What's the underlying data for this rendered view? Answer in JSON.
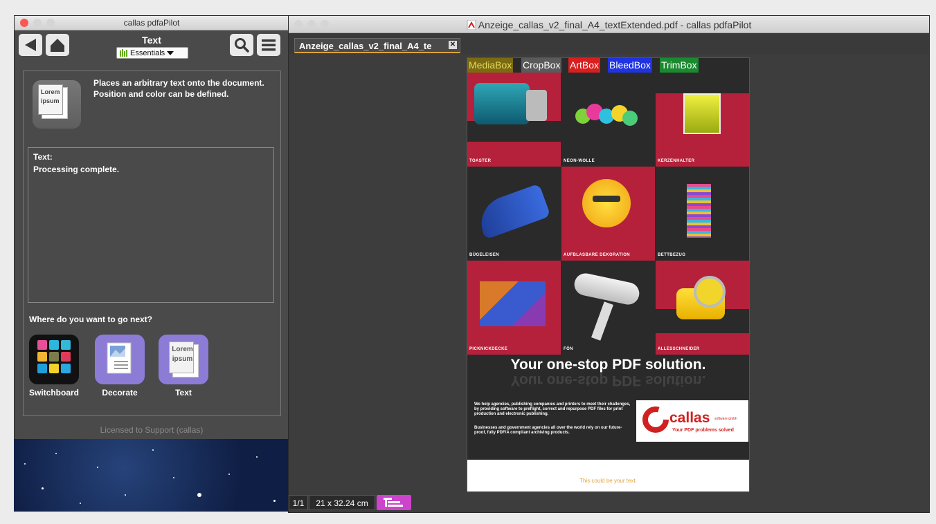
{
  "left_window": {
    "title": "callas pdfaPilot",
    "tool_name": "Text",
    "tool_group": "Essentials",
    "description": "Places an arbitrary text onto the document. Position and color can be defined.",
    "desc_icon_text": [
      "Lorem",
      "ipsum"
    ],
    "text_area": {
      "label": "Text:",
      "value": "Processing complete."
    },
    "next_prompt": "Where do you want to go next?",
    "apps": [
      {
        "label": "Switchboard",
        "icon": "switchboard-grid-icon"
      },
      {
        "label": "Decorate",
        "icon": "decorate-icon"
      },
      {
        "label": "Text",
        "icon": "lorem-ipsum-icon"
      }
    ],
    "license": "Licensed to Support (callas)"
  },
  "right_window": {
    "title": "Anzeige_callas_v2_final_A4_textExtended.pdf - callas pdfaPilot",
    "tab_label": "Anzeige_callas_v2_final_A4_te",
    "tab_close": "✕",
    "box_labels": [
      {
        "text": "MediaBox",
        "color": "#7a6b12",
        "fg": "#e6d75a"
      },
      {
        "text": "CropBox",
        "color": "#5a5a5a",
        "fg": "#ffffff"
      },
      {
        "text": "ArtBox",
        "color": "#d81f1f",
        "fg": "#ffffff"
      },
      {
        "text": "BleedBox",
        "color": "#1f33e0",
        "fg": "#ffffff"
      },
      {
        "text": "TrimBox",
        "color": "#1b8a2f",
        "fg": "#ffffff"
      }
    ],
    "products": [
      "Toaster",
      "Neon-Wolle",
      "Kerzenhalter",
      "Bügeleisen",
      "Aufblasbare Dekoration",
      "Bettbezug",
      "Picknickdecke",
      "Fön",
      "Allesschneider"
    ],
    "headline": "Your one-stop PDF solution.",
    "paragraph1": "We help agencies, publishing companies and printers to meet their challenges, by providing software to preflight, correct and repurpose PDF files for print production and electronic publishing.",
    "paragraph2": "Businesses and government agencies all over the world rely on our future-proof, fully PDF/A compliant archiving products.",
    "logo_text": "callas",
    "logo_small": "software gmbh",
    "logo_tagline": "Your PDF problems solved",
    "slug_text": "This could be your text.",
    "page_count": "1/1",
    "page_size": "21 x 32.24 cm"
  },
  "colors": {
    "accent_red": "#b5213a",
    "dark_cell": "#2a2a2a",
    "traffic_red": "#fc5753"
  }
}
